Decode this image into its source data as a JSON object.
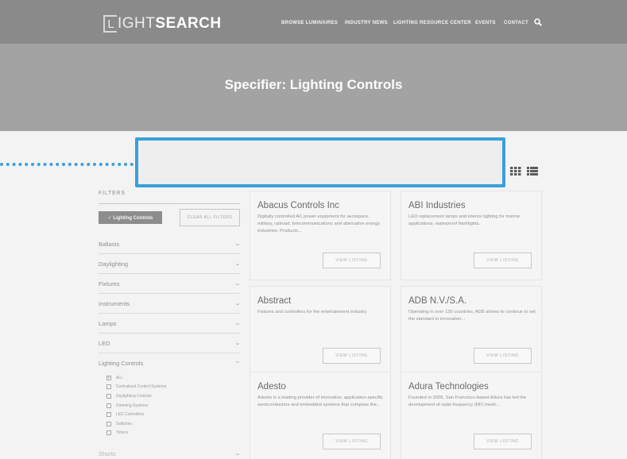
{
  "header": {
    "logo_mark": "L",
    "logo_light": "IGHT",
    "logo_bold": "SEARCH",
    "nav": [
      "BROWSE LUMINAIRES",
      "INDUSTRY NEWS",
      "LIGHTING RESOURCE CENTER",
      "EVENTS",
      "CONTACT"
    ],
    "search_icon": "search-icon"
  },
  "hero": {
    "title": "Specifier: Lighting Controls"
  },
  "filters": {
    "title": "FILTERS",
    "active_chip": "✓ Lighting Controls",
    "clear_label": "CLEAR ALL FILTERS",
    "categories": [
      "Ballasts",
      "Daylighting",
      "Fixtures",
      "Instruments",
      "Lamps",
      "LED"
    ],
    "open_category": "Lighting Controls",
    "options": [
      {
        "label": "ALL",
        "checked": true
      },
      {
        "label": "Centralized Control Systems",
        "checked": false
      },
      {
        "label": "Daylighting Controls",
        "checked": false
      },
      {
        "label": "Dimming Systems",
        "checked": false
      },
      {
        "label": "LED Controllers",
        "checked": false
      },
      {
        "label": "Switches",
        "checked": false
      },
      {
        "label": "Timers",
        "checked": false
      }
    ],
    "shorts_label": "Shorts"
  },
  "listings": [
    {
      "title": "Abacus Controls Inc",
      "desc": "Digitally controlled AC power equipment for aerospace, military, railroad, telecommunications and alternative energy industries. Products...",
      "button": "VIEW LISTING"
    },
    {
      "title": "ABI Industries",
      "desc": "LED replacement lamps and interior lighting for marine applications, waterproof flashlights.",
      "button": "VIEW LISTING"
    },
    {
      "title": "Abstract",
      "desc": "Fixtures and controllers for the entertainment industry.",
      "button": "VIEW LISTING"
    },
    {
      "title": "ADB N.V./S.A.",
      "desc": "Operating in over 130 countries, ADB strives to continue to set the standard in innovation...",
      "button": "VIEW LISTING"
    },
    {
      "title": "Adesto",
      "desc": "Adesto is a leading provider of innovative, application-specific semiconductors and embedded systems that comprise the...",
      "button": "VIEW LISTING"
    },
    {
      "title": "Adura Technologies",
      "desc": "Founded in 2005, San Francisco-based Adura has led the development of radio frequency (RF) mesh...",
      "button": "VIEW LISTING"
    }
  ],
  "colors": {
    "highlight": "#3aa0da",
    "header": "#8a8a8a",
    "hero": "#a3a3a3"
  }
}
